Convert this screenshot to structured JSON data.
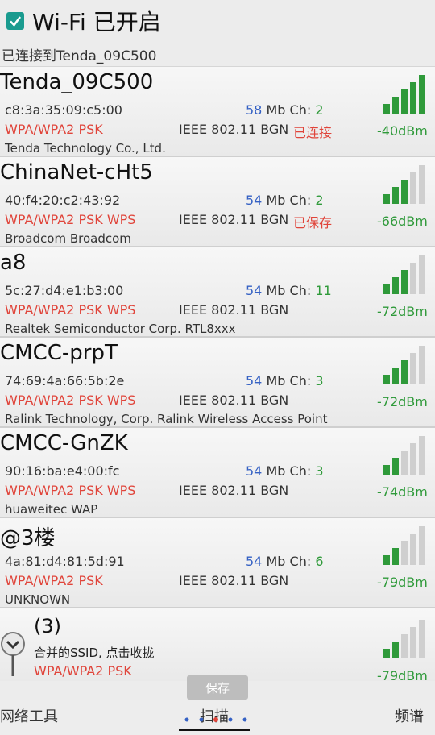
{
  "header": {
    "title": "Wi-Fi 已开启",
    "checkbox_checked": true,
    "subtitle": "已连接到Tenda_09C500"
  },
  "colors": {
    "accent": "#1a9b8f",
    "red": "#e0443a",
    "green": "#2f9a3a",
    "blue": "#3561c4"
  },
  "networks": [
    {
      "ssid": "Tenda_09C500",
      "mac": "c8:3a:35:09:c5:00",
      "speed": "58",
      "mb_unit": "Mb",
      "ch_label": "Ch:",
      "channel": "2",
      "security": "WPA/WPA2 PSK",
      "standard": "IEEE 802.11 BGN",
      "state": "已连接",
      "vendor": "Tenda Technology Co., Ltd.",
      "signal": "-40dBm",
      "bars": 5
    },
    {
      "ssid": "ChinaNet-cHt5",
      "mac": "40:f4:20:c2:43:92",
      "speed": "54",
      "mb_unit": "Mb",
      "ch_label": "Ch:",
      "channel": "2",
      "security": "WPA/WPA2 PSK WPS",
      "standard": "IEEE 802.11 BGN",
      "state": "已保存",
      "vendor": "Broadcom Broadcom",
      "signal": "-66dBm",
      "bars": 3
    },
    {
      "ssid": "a8",
      "mac": "5c:27:d4:e1:b3:00",
      "speed": "54",
      "mb_unit": "Mb",
      "ch_label": "Ch:",
      "channel": "11",
      "security": "WPA/WPA2 PSK WPS",
      "standard": "IEEE 802.11 BGN",
      "state": "",
      "vendor": "Realtek Semiconductor Corp. RTL8xxx",
      "signal": "-72dBm",
      "bars": 3
    },
    {
      "ssid": "CMCC-prpT",
      "mac": "74:69:4a:66:5b:2e",
      "speed": "54",
      "mb_unit": "Mb",
      "ch_label": "Ch:",
      "channel": "3",
      "security": "WPA/WPA2 PSK WPS",
      "standard": "IEEE 802.11 BGN",
      "state": "",
      "vendor": "Ralink Technology, Corp. Ralink Wireless Access Point",
      "signal": "-72dBm",
      "bars": 3
    },
    {
      "ssid": "CMCC-GnZK",
      "mac": "90:16:ba:e4:00:fc",
      "speed": "54",
      "mb_unit": "Mb",
      "ch_label": "Ch:",
      "channel": "3",
      "security": "WPA/WPA2 PSK WPS",
      "standard": "IEEE 802.11 BGN",
      "state": "",
      "vendor": "huaweitec WAP",
      "signal": "-74dBm",
      "bars": 2
    },
    {
      "ssid": "@3楼",
      "mac": "4a:81:d4:81:5d:91",
      "speed": "54",
      "mb_unit": "Mb",
      "ch_label": "Ch:",
      "channel": "6",
      "security": "WPA/WPA2 PSK",
      "standard": "IEEE 802.11 BGN",
      "state": "",
      "vendor": "UNKNOWN",
      "signal": "-79dBm",
      "bars": 2
    }
  ],
  "group": {
    "count": "(3)",
    "text": "合并的SSID, 点击收拢",
    "security": "WPA/WPA2 PSK",
    "signal": "-79dBm",
    "bars": 2
  },
  "toast": "保存",
  "tabs": {
    "left": "网络工具",
    "middle": "扫描",
    "right": "频谱",
    "active": "middle"
  }
}
